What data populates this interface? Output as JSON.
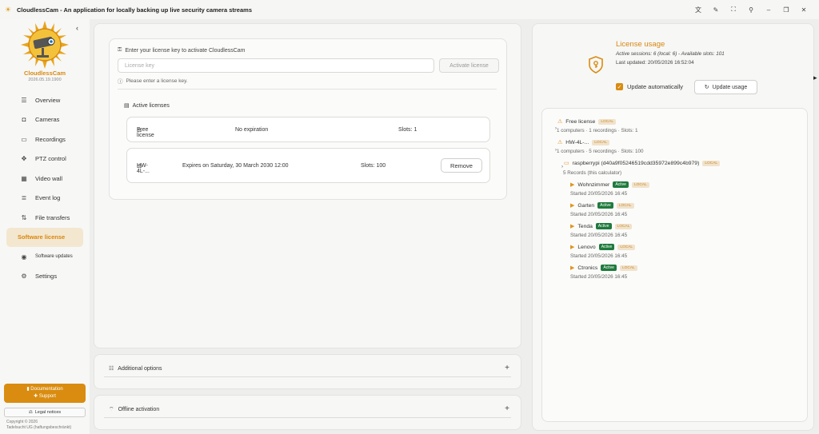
{
  "window": {
    "title": "CloudlessCam - An application for locally backing up live security camera streams",
    "controls": [
      "translate-icon",
      "accessibility-icon",
      "fullscreen-icon",
      "pin-icon",
      "minimize-icon",
      "restore-icon",
      "close-icon"
    ]
  },
  "sidebar": {
    "brand": "CloudlessCam",
    "version": "2026.05.19.1900",
    "items": [
      {
        "label": "Overview",
        "icon": "overview-icon"
      },
      {
        "label": "Cameras",
        "icon": "camera-icon"
      },
      {
        "label": "Recordings",
        "icon": "recordings-icon"
      },
      {
        "label": "PTZ control",
        "icon": "ptz-icon"
      },
      {
        "label": "Video wall",
        "icon": "video-wall-icon"
      },
      {
        "label": "Event log",
        "icon": "event-log-icon"
      },
      {
        "label": "File transfers",
        "icon": "file-transfer-icon"
      },
      {
        "label": "Software license",
        "icon": "",
        "active": true
      },
      {
        "label": "Software updates",
        "icon": "updates-icon"
      },
      {
        "label": "Settings",
        "icon": "settings-icon"
      }
    ],
    "doc_label": "Documentation",
    "support_label": "Support",
    "legal_label": "Legal notices",
    "copyright": "Copyright © 2026",
    "company": "Tadelsucht UG (haftungsbeschränkt)"
  },
  "license": {
    "prompt": "Enter your license key to activate CloudlessCam",
    "key_placeholder": "License key",
    "activate_label": "Activate license",
    "hint": "Please enter a license key.",
    "active_heading": "Active licenses",
    "rows": [
      {
        "name": "Free license",
        "expiry": "No expiration",
        "slots": "Slots: 1"
      },
      {
        "name": "HW-4L-...",
        "expiry": "Expires on Saturday, 30 March 2030 12:00",
        "slots": "Slots: 100",
        "remove_label": "Remove"
      }
    ]
  },
  "accordions": {
    "additional": "Additional options",
    "offline": "Offline activation"
  },
  "usage": {
    "title": "License usage",
    "sessions": "Active sessions: 6 (local: 6) - Available slots: 101",
    "updated": "Last updated: 20/05/2026 16:52:04",
    "auto_label": "Update automatically",
    "auto_checked": true,
    "update_label": "Update usage",
    "tree": {
      "free": {
        "name": "Free license",
        "badge": "LOCAL",
        "summary": "1 computers · 1 recordings · Slots: 1"
      },
      "hw": {
        "name": "HW-4L-...",
        "badge": "LOCAL",
        "summary": "1 computers · 5 recordings · Slots: 100"
      },
      "host": {
        "name": "raspberrypi (d40a9f05246519cdd35972e899c4b979)",
        "badge": "LOCAL",
        "summary": "5 Records (this calculator)"
      },
      "cams": [
        {
          "name": "Wohnzimmer",
          "status": "Active",
          "badge": "LOCAL",
          "started": "Started 20/05/2026 16:45"
        },
        {
          "name": "Garten",
          "status": "Active",
          "badge": "LOCAL",
          "started": "Started 20/05/2026 16:45"
        },
        {
          "name": "Tenda",
          "status": "Active",
          "badge": "LOCAL",
          "started": "Started 20/05/2026 16:45"
        },
        {
          "name": "Lenovo",
          "status": "Active",
          "badge": "LOCAL",
          "started": "Started 20/05/2026 16:45"
        },
        {
          "name": "Ctronics",
          "status": "Active",
          "badge": "LOCAL",
          "started": "Started 20/05/2026 16:45"
        }
      ]
    }
  },
  "colors": {
    "accent": "#d98c0f",
    "active_badge": "#1f7a3d",
    "local_badge_bg": "#f1e2cb"
  }
}
